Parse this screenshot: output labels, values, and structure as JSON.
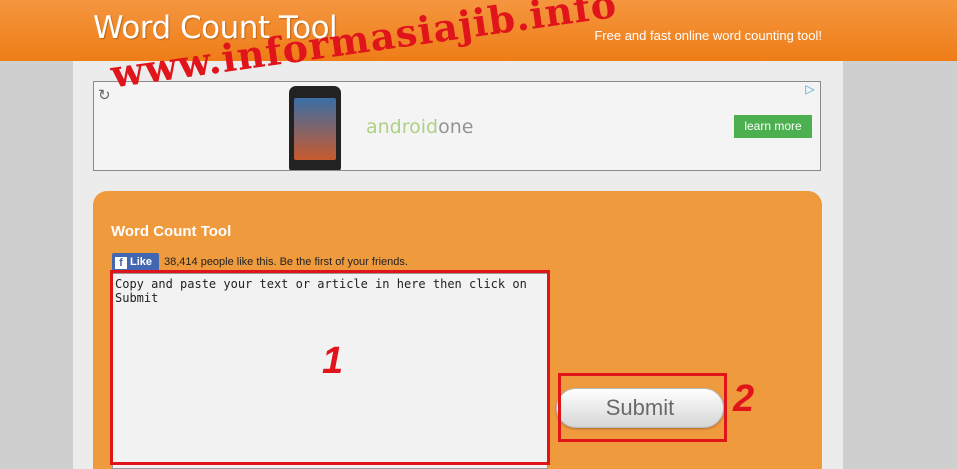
{
  "header": {
    "logo": "Word Count Tool",
    "tagline": "Free and fast online word counting tool!"
  },
  "ad": {
    "refresh_icon": "refresh-icon",
    "adchoices_icon": "adchoices-icon",
    "brand_part1": "android",
    "brand_part2": "one",
    "button": "learn more"
  },
  "watermark": "www.informasiajib.info",
  "panel": {
    "title": "Word Count Tool",
    "like_label": "Like",
    "like_text": "38,414 people like this. Be the first of your friends.",
    "textarea_text": "Copy and paste your text or article in here then click on Submit",
    "submit_label": "Submit"
  },
  "annotations": {
    "label1": "1",
    "label2": "2"
  },
  "colors": {
    "header": "#ef7d17",
    "panel": "#f09a3e",
    "annotation": "#e0141b",
    "fb": "#4267b2"
  }
}
